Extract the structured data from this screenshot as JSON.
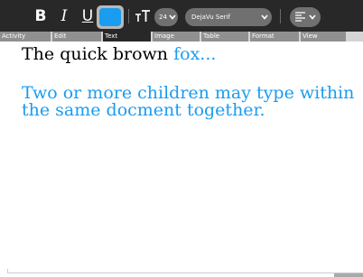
{
  "toolbar": {
    "bold_label": "B",
    "italic_label": "I",
    "underline_label": "U",
    "text_color": "#1a9cf0",
    "text_size_icon": "text-size-icon",
    "font_size_value": "24",
    "font_family_value": "DejaVu Serif",
    "align_icon": "align-left-icon"
  },
  "tabs": [
    {
      "label": "Activity",
      "active": false
    },
    {
      "label": "Edit",
      "active": false
    },
    {
      "label": "Text",
      "active": true
    },
    {
      "label": "Image",
      "active": false
    },
    {
      "label": "Table",
      "active": false
    },
    {
      "label": "Format",
      "active": false
    },
    {
      "label": "View",
      "active": false
    }
  ],
  "document": {
    "line1_black": "The quick brown ",
    "line1_blue": "fox...",
    "para2_line1": "Two or more children may type within",
    "para2_line2": "the same docment together.",
    "blue_color": "#1a9cf0"
  }
}
